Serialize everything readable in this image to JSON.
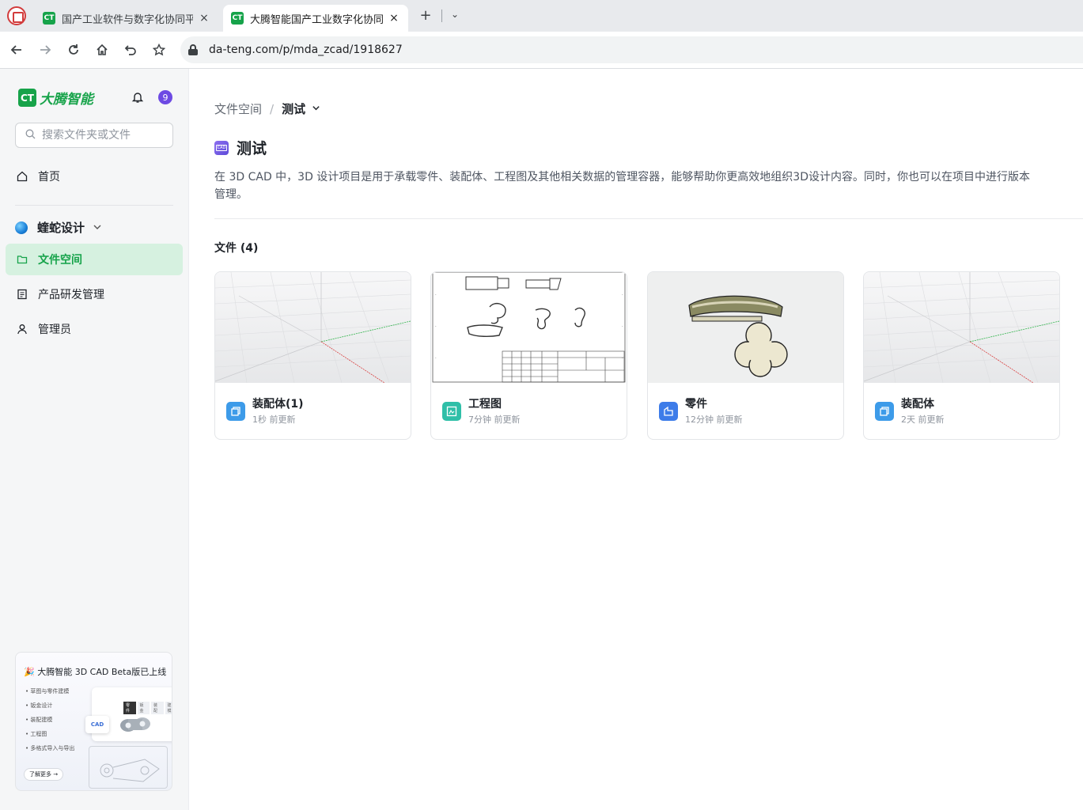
{
  "browser": {
    "tabs": [
      {
        "title": "国产工业软件与数字化协同平",
        "favicon": "CT",
        "active": false
      },
      {
        "title": "大腾智能国产工业数字化协同",
        "favicon": "CT",
        "active": true
      }
    ],
    "new_tab_symbol": "+",
    "close_symbol": "×",
    "tab_list_symbol": "⌄",
    "url": "da-teng.com/p/mda_zcad/1918627"
  },
  "sidebar": {
    "logo_mark": "CT",
    "logo_text": "大腾智能",
    "notification_count": "9",
    "search_placeholder": "搜索文件夹或文件",
    "home_label": "首页",
    "team_name": "蝰蛇设计",
    "items": [
      {
        "label": "文件空间",
        "icon": "folder-icon",
        "selected": true
      },
      {
        "label": "产品研发管理",
        "icon": "document-list-icon",
        "selected": false
      },
      {
        "label": "管理员",
        "icon": "user-icon",
        "selected": false
      }
    ],
    "promo": {
      "title": "🎉 大腾智能 3D CAD Beta版已上线",
      "features": [
        "草图与零件建模",
        "钣金设计",
        "装配建模",
        "工程图",
        "多格式导入与导出"
      ],
      "tabs": [
        "零件",
        "钣金",
        "装配",
        "建模"
      ],
      "chip": "CAD",
      "cta": "了解更多 →"
    }
  },
  "main": {
    "breadcrumb": {
      "root": "文件空间",
      "separator": "/",
      "current": "测试"
    },
    "title_icon_text": "CAD",
    "title": "测试",
    "description": "在 3D CAD 中，3D 设计项目是用于承载零件、装配体、工程图及其他相关数据的管理容器，能够帮助你更高效地组织3D设计内容。同时，你也可以在项目中进行版本管理。",
    "files_heading": "文件 (4)",
    "files": [
      {
        "name": "装配体(1)",
        "updated": "1秒 前更新",
        "type": "assembly",
        "icon_color": "#3d9be9"
      },
      {
        "name": "工程图",
        "updated": "7分钟 前更新",
        "type": "drawing",
        "icon_color": "#2fbfa8"
      },
      {
        "name": "零件",
        "updated": "12分钟 前更新",
        "type": "part",
        "icon_color": "#3d7ce9"
      },
      {
        "name": "装配体",
        "updated": "2天 前更新",
        "type": "assembly",
        "icon_color": "#3d9be9"
      }
    ]
  },
  "colors": {
    "brand": "#17a34a",
    "selected_bg": "#d6f1e0",
    "badge": "#6d4ae3"
  }
}
